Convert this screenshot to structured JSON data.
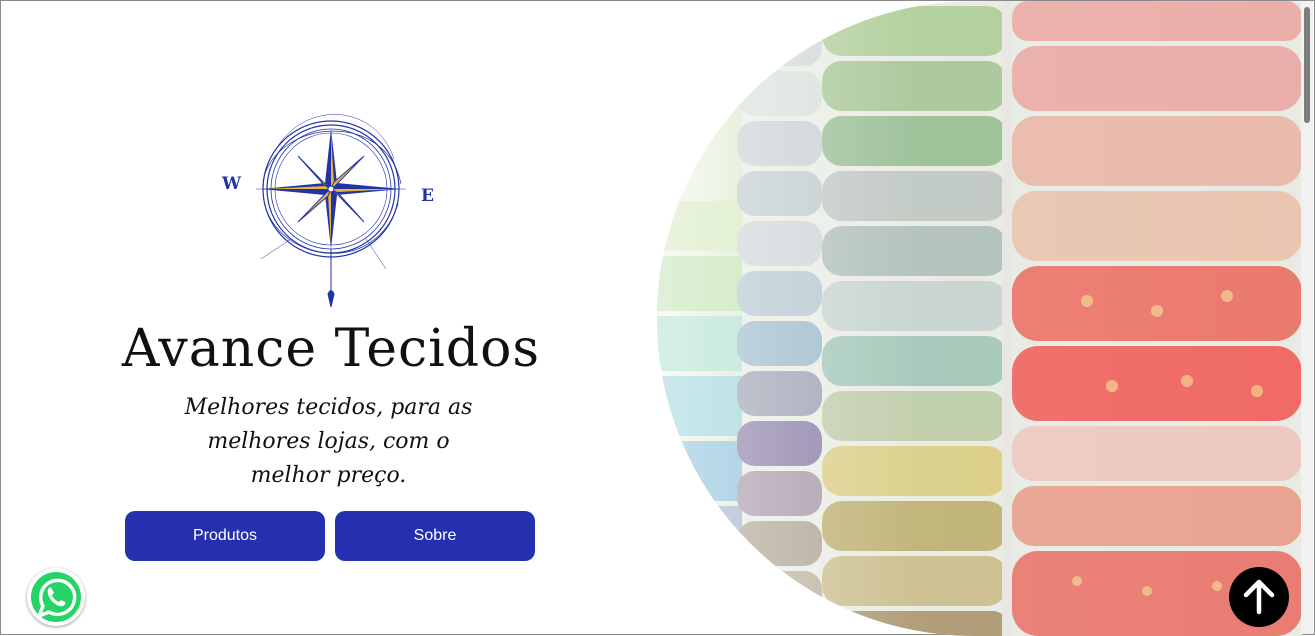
{
  "brand": {
    "name": "Avance Tecidos",
    "tagline": "Melhores tecidos, para as melhores lojas, com o melhor preço."
  },
  "logo": {
    "icon": "compass-rose-icon",
    "west_letter": "W",
    "east_letter": "E",
    "colors": {
      "primary": "#2233a8",
      "accent": "#e9b830"
    }
  },
  "buttons": {
    "products_label": "Produtos",
    "about_label": "Sobre"
  },
  "hero_image": {
    "subject": "fabric-rolls-image"
  },
  "floating": {
    "whatsapp_icon": "whatsapp-icon",
    "back_to_top_icon": "arrow-up-icon"
  },
  "colors": {
    "button_bg": "#2430b0",
    "button_text": "#ffffff",
    "whatsapp_green": "#25d366",
    "back_to_top_bg": "#000000"
  }
}
